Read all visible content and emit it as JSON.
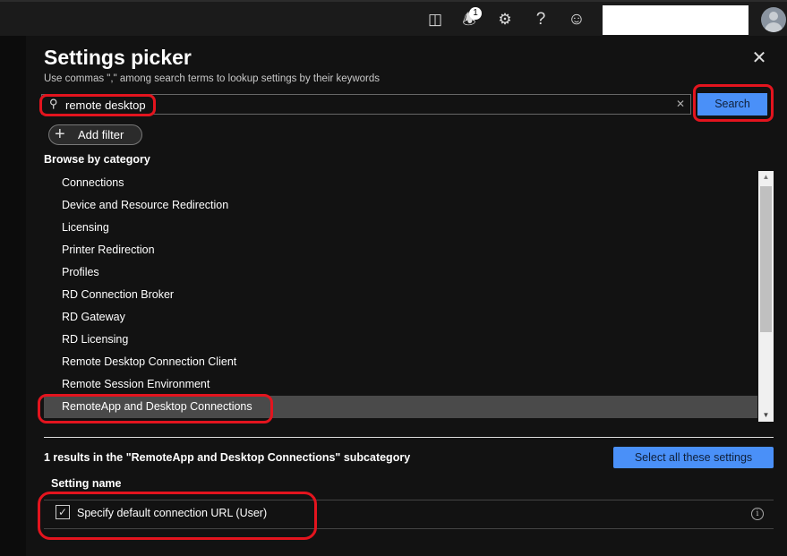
{
  "topbar": {
    "icons": [
      "directory-filter-icon",
      "bell-icon",
      "gear-icon",
      "help-icon",
      "feedback-smiley-icon"
    ],
    "notification_count": "1"
  },
  "panel": {
    "title": "Settings picker",
    "subtitle": "Use commas \",\" among search terms to lookup settings by their keywords",
    "search": {
      "value": "remote desktop",
      "placeholder": ""
    },
    "search_button": "Search",
    "add_filter": "Add filter",
    "browse_heading": "Browse by category",
    "categories": [
      {
        "label": "Connections"
      },
      {
        "label": "Device and Resource Redirection"
      },
      {
        "label": "Licensing"
      },
      {
        "label": "Printer Redirection"
      },
      {
        "label": "Profiles"
      },
      {
        "label": "RD Connection Broker"
      },
      {
        "label": "RD Gateway"
      },
      {
        "label": "RD Licensing"
      },
      {
        "label": "Remote Desktop Connection Client"
      },
      {
        "label": "Remote Session Environment"
      },
      {
        "label": "RemoteApp and Desktop Connections",
        "selected": true
      }
    ],
    "results_text": "1 results in the \"RemoteApp and Desktop Connections\" subcategory",
    "select_all_button": "Select all these settings",
    "column_header": "Setting name",
    "settings": [
      {
        "label": "Specify default connection URL (User)",
        "checked": true
      }
    ]
  },
  "colors": {
    "accent": "#4a90f8",
    "highlight": "#e3141e",
    "selected_row": "#4a4a4a",
    "panel_bg": "#121212"
  }
}
